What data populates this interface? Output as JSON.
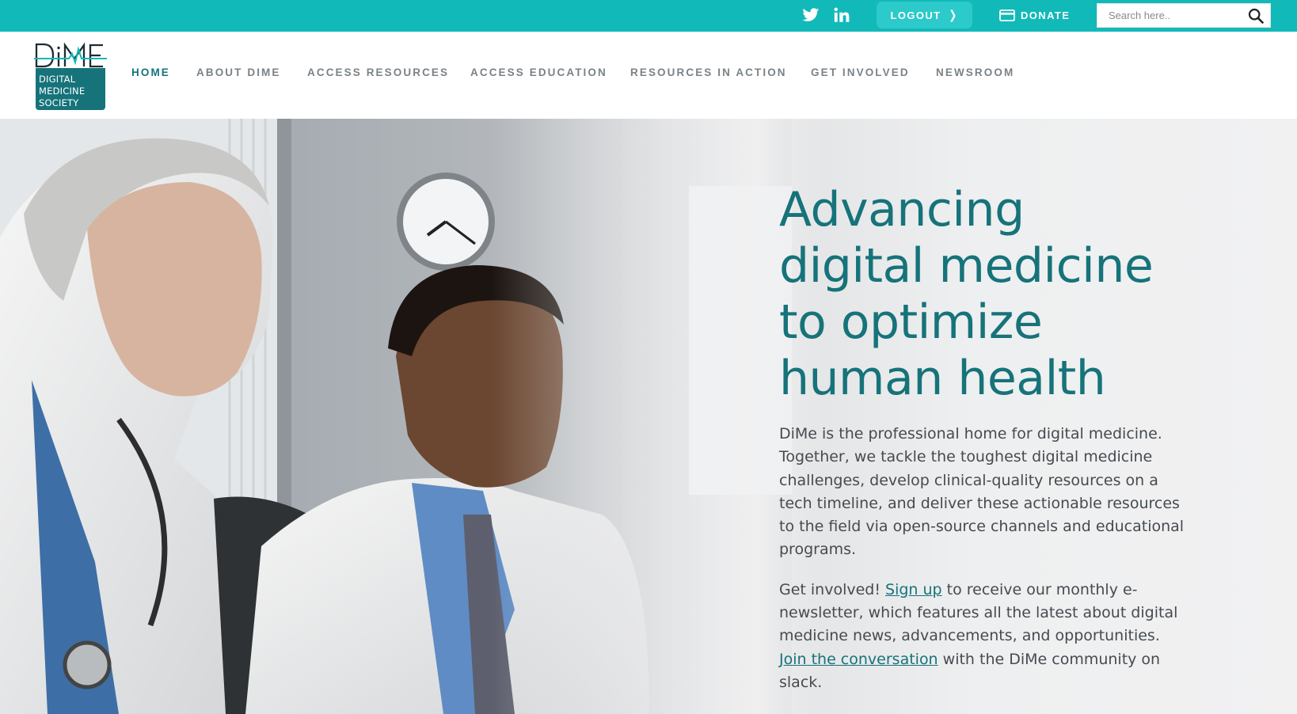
{
  "topbar": {
    "background": "#12b9b9",
    "social": [
      {
        "name": "twitter",
        "icon": "twitter-icon"
      },
      {
        "name": "linkedin",
        "icon": "linkedin-icon"
      }
    ],
    "logout_label": "LOGOUT",
    "logout_icon": "chevron-right-icon",
    "donate_label": "DONATE",
    "donate_icon": "credit-card-icon",
    "search": {
      "placeholder": "Search here..",
      "value": "",
      "icon": "search-icon"
    }
  },
  "logo": {
    "wordmark": "DiMe",
    "lines": [
      "DIGITAL",
      "MEDICINE",
      "SOCIETY"
    ],
    "color": "#16737a"
  },
  "nav": {
    "items": [
      {
        "label": "HOME",
        "active": true
      },
      {
        "label": "ABOUT DIME"
      },
      {
        "label": "ACCESS RESOURCES"
      },
      {
        "label": "ACCESS EDUCATION"
      },
      {
        "label": "RESOURCES IN ACTION"
      },
      {
        "label": "GET INVOLVED"
      },
      {
        "label": "NEWSROOM"
      }
    ],
    "active_color": "#16737a",
    "inactive_color": "#7b8287"
  },
  "hero": {
    "title_lines": [
      "Advancing",
      "digital medicine",
      "to optimize",
      "human health"
    ],
    "paragraph1": "DiMe is the professional home for digital medicine. Together, we tackle the toughest digital medicine challenges, develop clinical-quality resources on a tech timeline, and deliver these actionable resources to the field via open-source channels and educational programs.",
    "p2_before": "Get involved! ",
    "p2_link1": "Sign up",
    "p2_middle": " to receive our monthly e-newsletter, which features all the latest about digital medicine news, advancements, and opportunities. ",
    "p2_link2": "Join the conversation",
    "p2_after": " with the DiMe community on slack.",
    "photo": "two-doctors-looking-at-screen-photo",
    "accent": "#16737a"
  }
}
